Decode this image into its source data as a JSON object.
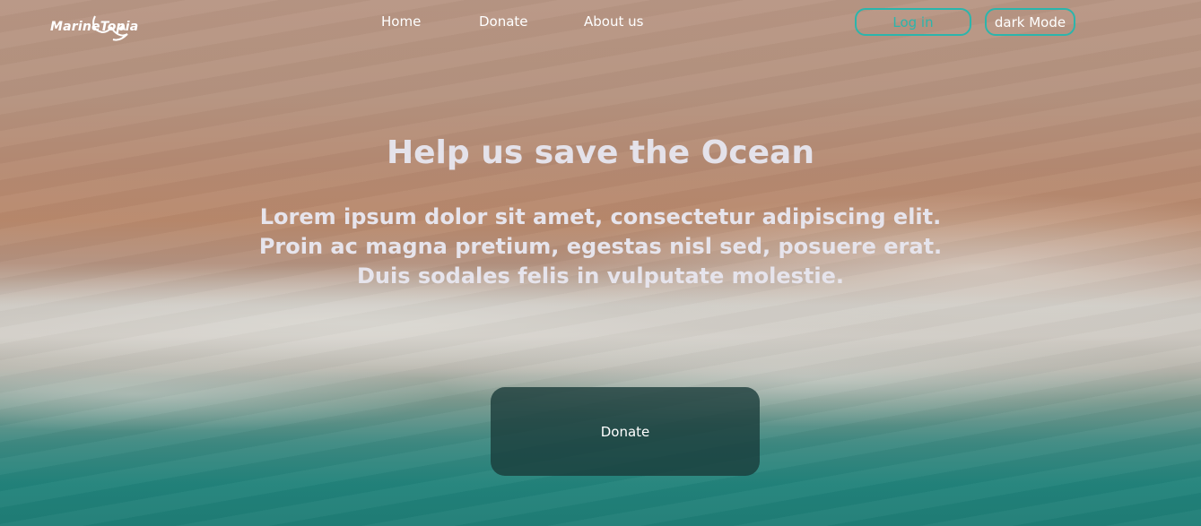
{
  "brand": {
    "name": "MarineTopia"
  },
  "nav": {
    "items": [
      {
        "label": "Home"
      },
      {
        "label": "Donate"
      },
      {
        "label": "About us"
      }
    ],
    "login_label": "Log in",
    "dark_mode_label": "dark Mode"
  },
  "hero": {
    "title": "Help us save the Ocean",
    "lines": [
      "Lorem ipsum dolor sit amet, consectetur adipiscing elit.",
      "Proin ac magna pretium, egestas nisl sed, posuere erat.",
      "Duis sodales felis in vulputate molestie."
    ],
    "cta_label": "Donate"
  },
  "colors": {
    "accent": "#2bb5ac",
    "cta_background": "#183a38",
    "text_light": "#e4e2ea"
  },
  "icons": {
    "logo": "whale-tail-icon"
  }
}
